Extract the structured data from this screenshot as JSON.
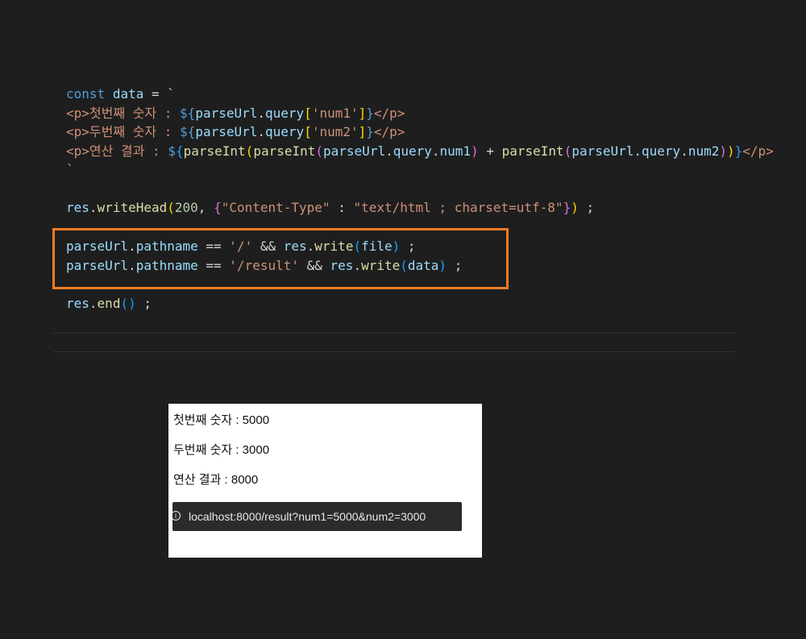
{
  "code": {
    "l1": {
      "kw": "const",
      "var": "data",
      "op": " = `"
    },
    "l2": {
      "open_tag": "<p>",
      "label": "첫번째 숫자 : ",
      "expr_start": "${",
      "obj": "parseUrl",
      "prop": "query",
      "key": "'num1'",
      "close": "}",
      "close_tag": "</p>"
    },
    "l3": {
      "open_tag": "<p>",
      "label": "두번째 숫자 : ",
      "expr_start": "${",
      "obj": "parseUrl",
      "prop": "query",
      "key": "'num2'",
      "close": "}",
      "close_tag": "</p>"
    },
    "l4": {
      "open_tag": "<p>",
      "label": "연산 결과 : ",
      "expr_start": "${",
      "fn": "parseInt",
      "obj": "parseUrl",
      "prop1": "query",
      "num1": "num1",
      "plus": " + ",
      "num2": "num2",
      "close": "}",
      "close_tag": "</p>"
    },
    "l5": {
      "tick": "`"
    },
    "l6": {
      "obj": "res",
      "method": "writeHead",
      "status": "200",
      "key": "\"Content-Type\"",
      "colon": " : ",
      "value": "\"text/html ; charset=utf-8\"",
      "end": " ;"
    },
    "l7": {
      "obj": "parseUrl",
      "prop": "pathname",
      "eq": " == ",
      "path": "'/'",
      "and": " && ",
      "res": "res",
      "method": "write",
      "arg": "file",
      "end": " ;"
    },
    "l8": {
      "obj": "parseUrl",
      "prop": "pathname",
      "eq": " == ",
      "path": "'/result'",
      "and": " && ",
      "res": "res",
      "method": "write",
      "arg": "data",
      "end": " ;"
    },
    "l9": {
      "obj": "res",
      "method": "end",
      "end": " ;"
    }
  },
  "browser": {
    "lines": [
      "첫번째 숫자 : 5000",
      "두번째 숫자 : 3000",
      "연산 결과 : 8000"
    ],
    "url": "localhost:8000/result?num1=5000&num2=3000",
    "info_glyph": "i"
  },
  "colors": {
    "highlight_border": "#f07c25",
    "editor_bg": "#1e1e1e"
  }
}
